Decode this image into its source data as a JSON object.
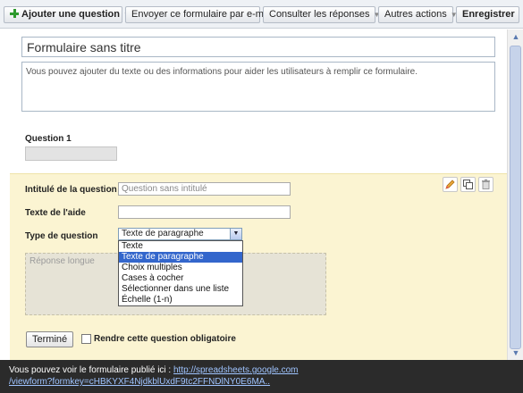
{
  "toolbar": {
    "add_question": "Ajouter une question",
    "email_form": "Envoyer ce formulaire par e-mail",
    "see_responses": "Consulter les réponses",
    "more_actions": "Autres actions",
    "save": "Enregistrer"
  },
  "form": {
    "title": "Formulaire sans titre",
    "description": "Vous pouvez ajouter du texte ou des informations pour aider les utilisateurs à remplir ce formulaire."
  },
  "question1": {
    "label": "Question 1"
  },
  "editor": {
    "title_label": "Intitulé de la question",
    "title_placeholder": "Question sans intitulé",
    "help_label": "Texte de l'aide",
    "help_value": "",
    "type_label": "Type de question",
    "type_selected": "Texte de paragraphe",
    "type_options": [
      "Texte",
      "Texte de paragraphe",
      "Choix multiples",
      "Cases à cocher",
      "Sélectionner dans une liste",
      "Échelle (1-n)"
    ],
    "long_answer_placeholder": "Réponse longue",
    "done_button": "Terminé",
    "required_label": "Rendre cette question obligatoire"
  },
  "notice": {
    "text": "Vous pouvez voir le formulaire publié ici : ",
    "link_line1": "http://spreadsheets.google.com",
    "link_line2": "/viewform?formkey=cHBKYXF4NjdkblUxdF9tc2FFNDlNY0E6MA.."
  },
  "colors": {
    "editor_bg": "#fbf4d2",
    "selection": "#3366cc",
    "notice_bg": "#2b2b2b",
    "link": "#9fc4ff"
  },
  "icons": [
    "plus-icon",
    "pencil-icon",
    "duplicate-icon",
    "trash-icon",
    "scroll-up-icon",
    "scroll-down-icon",
    "dropdown-arrow-icon"
  ]
}
